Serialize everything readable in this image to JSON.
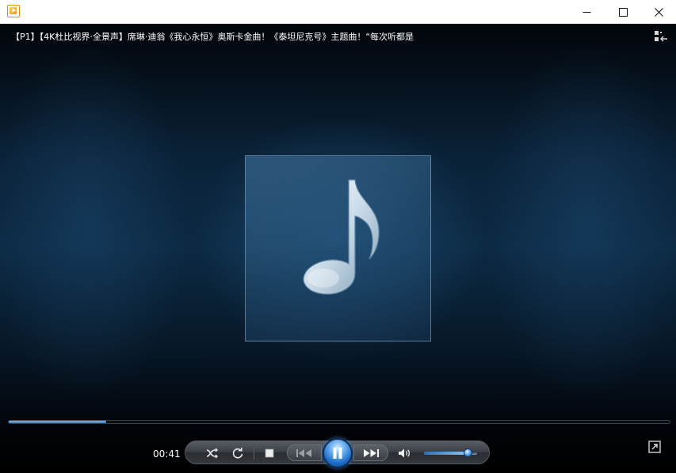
{
  "window": {
    "minimize_label": "minimize",
    "maximize_label": "maximize",
    "close_label": "close"
  },
  "video": {
    "title": "【P1】【4K杜比视界·全景声】席琳·迪翁《我心永恒》奥斯卡金曲！《泰坦尼克号》主题曲！“每次听都是"
  },
  "playback": {
    "current_time": "00:41",
    "progress_fraction": 0.148,
    "volume_fraction": 0.82,
    "state": "playing"
  },
  "icons": {
    "app": "media-player-icon",
    "playlist": "playlist-toggle-icon",
    "art": "music-note-icon",
    "shuffle": "shuffle-icon",
    "repeat": "repeat-icon",
    "stop": "stop-icon",
    "previous": "previous-icon",
    "pause": "pause-icon",
    "next": "next-icon",
    "volume": "volume-icon",
    "fullscreen": "fullscreen-icon"
  },
  "colors": {
    "accent": "#2f7fd2",
    "background": "#0c2a44"
  }
}
